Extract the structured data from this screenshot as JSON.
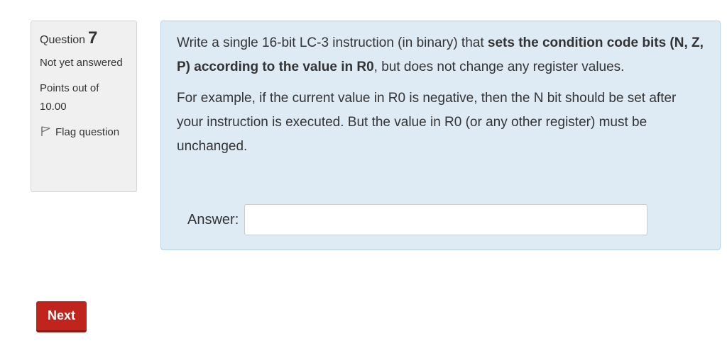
{
  "question_info": {
    "question_label": "Question",
    "question_number": "7",
    "state": "Not yet answered",
    "grade_label": "Points out of",
    "grade_value": "10.00",
    "flag_label": "Flag question",
    "flag_icon": "flag-icon"
  },
  "question": {
    "p1_a": "Write a single 16-bit LC-3 instruction (in binary) that ",
    "p1_bold": "sets the condition code bits (N, Z, P) according to the value in R0",
    "p1_b": ", but does not change any register values.",
    "p2": "For example, if the current value in R0 is negative, then the N bit should be set after your instruction is executed.  But the value in R0 (or any other register) must be unchanged.",
    "answer_label": "Answer:",
    "answer_value": ""
  },
  "navigation": {
    "next_label": "Next"
  },
  "colors": {
    "content_bg": "#deebf5",
    "info_bg": "#f0f0f0",
    "next_button": "#c1241c"
  }
}
